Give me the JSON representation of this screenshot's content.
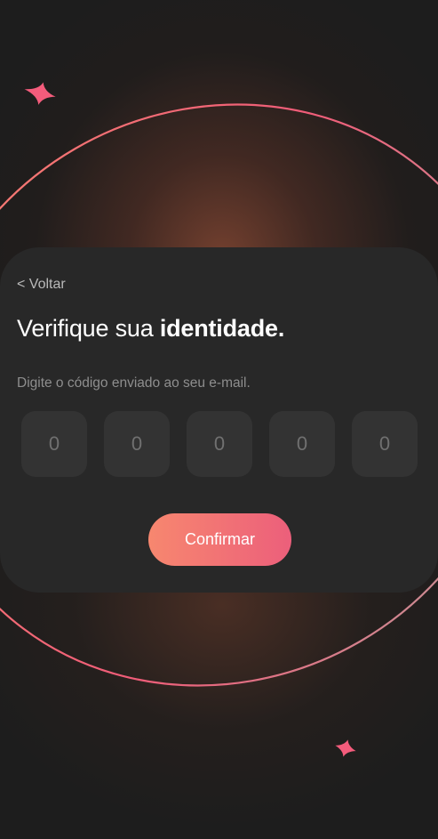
{
  "back": {
    "label": "< Voltar"
  },
  "heading": {
    "normal": "Verifique sua ",
    "bold": "identidade."
  },
  "instruction": "Digite o código enviado ao seu e-mail.",
  "code": {
    "digits": [
      "",
      "",
      "",
      "",
      ""
    ],
    "placeholders": [
      "0",
      "0",
      "0",
      "0",
      "0"
    ]
  },
  "confirm": {
    "label": "Confirmar"
  },
  "colors": {
    "background": "#1d1d1d",
    "card": "#282828",
    "code_box": "#333333",
    "accent_start": "#f7876f",
    "accent_end": "#ec5f7b",
    "sparkle": "#f45c7c"
  },
  "icons": [
    "sparkle-icon",
    "sparkle-icon"
  ]
}
